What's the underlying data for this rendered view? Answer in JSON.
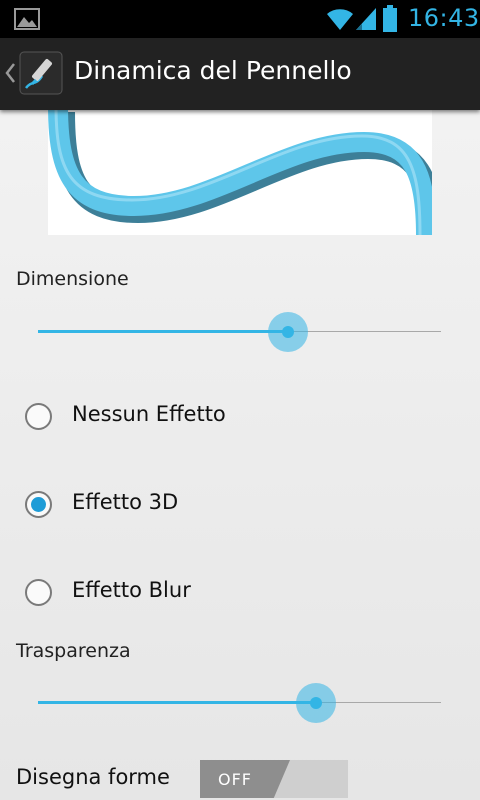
{
  "status_bar": {
    "time": "16:43",
    "icons": [
      "gallery-icon",
      "wifi-icon",
      "signal-icon",
      "battery-icon"
    ],
    "accent_color": "#33b5e5"
  },
  "action_bar": {
    "title": "Dinamica del Pennello",
    "icons": [
      "back-chevron-icon",
      "brush-app-icon"
    ]
  },
  "preview": {
    "stroke_color": "#5ec6ea",
    "shadow_color": "#3d7f98"
  },
  "size_setting": {
    "label": "Dimensione",
    "value_fraction": 0.62
  },
  "effects": {
    "options": [
      {
        "label": "Nessun Effetto",
        "checked": false
      },
      {
        "label": "Effetto 3D",
        "checked": true
      },
      {
        "label": "Effetto Blur",
        "checked": false
      }
    ]
  },
  "transparency_setting": {
    "label": "Trasparenza",
    "value_fraction": 0.69
  },
  "draw_shapes": {
    "label": "Disegna forme",
    "state_label": "OFF"
  }
}
